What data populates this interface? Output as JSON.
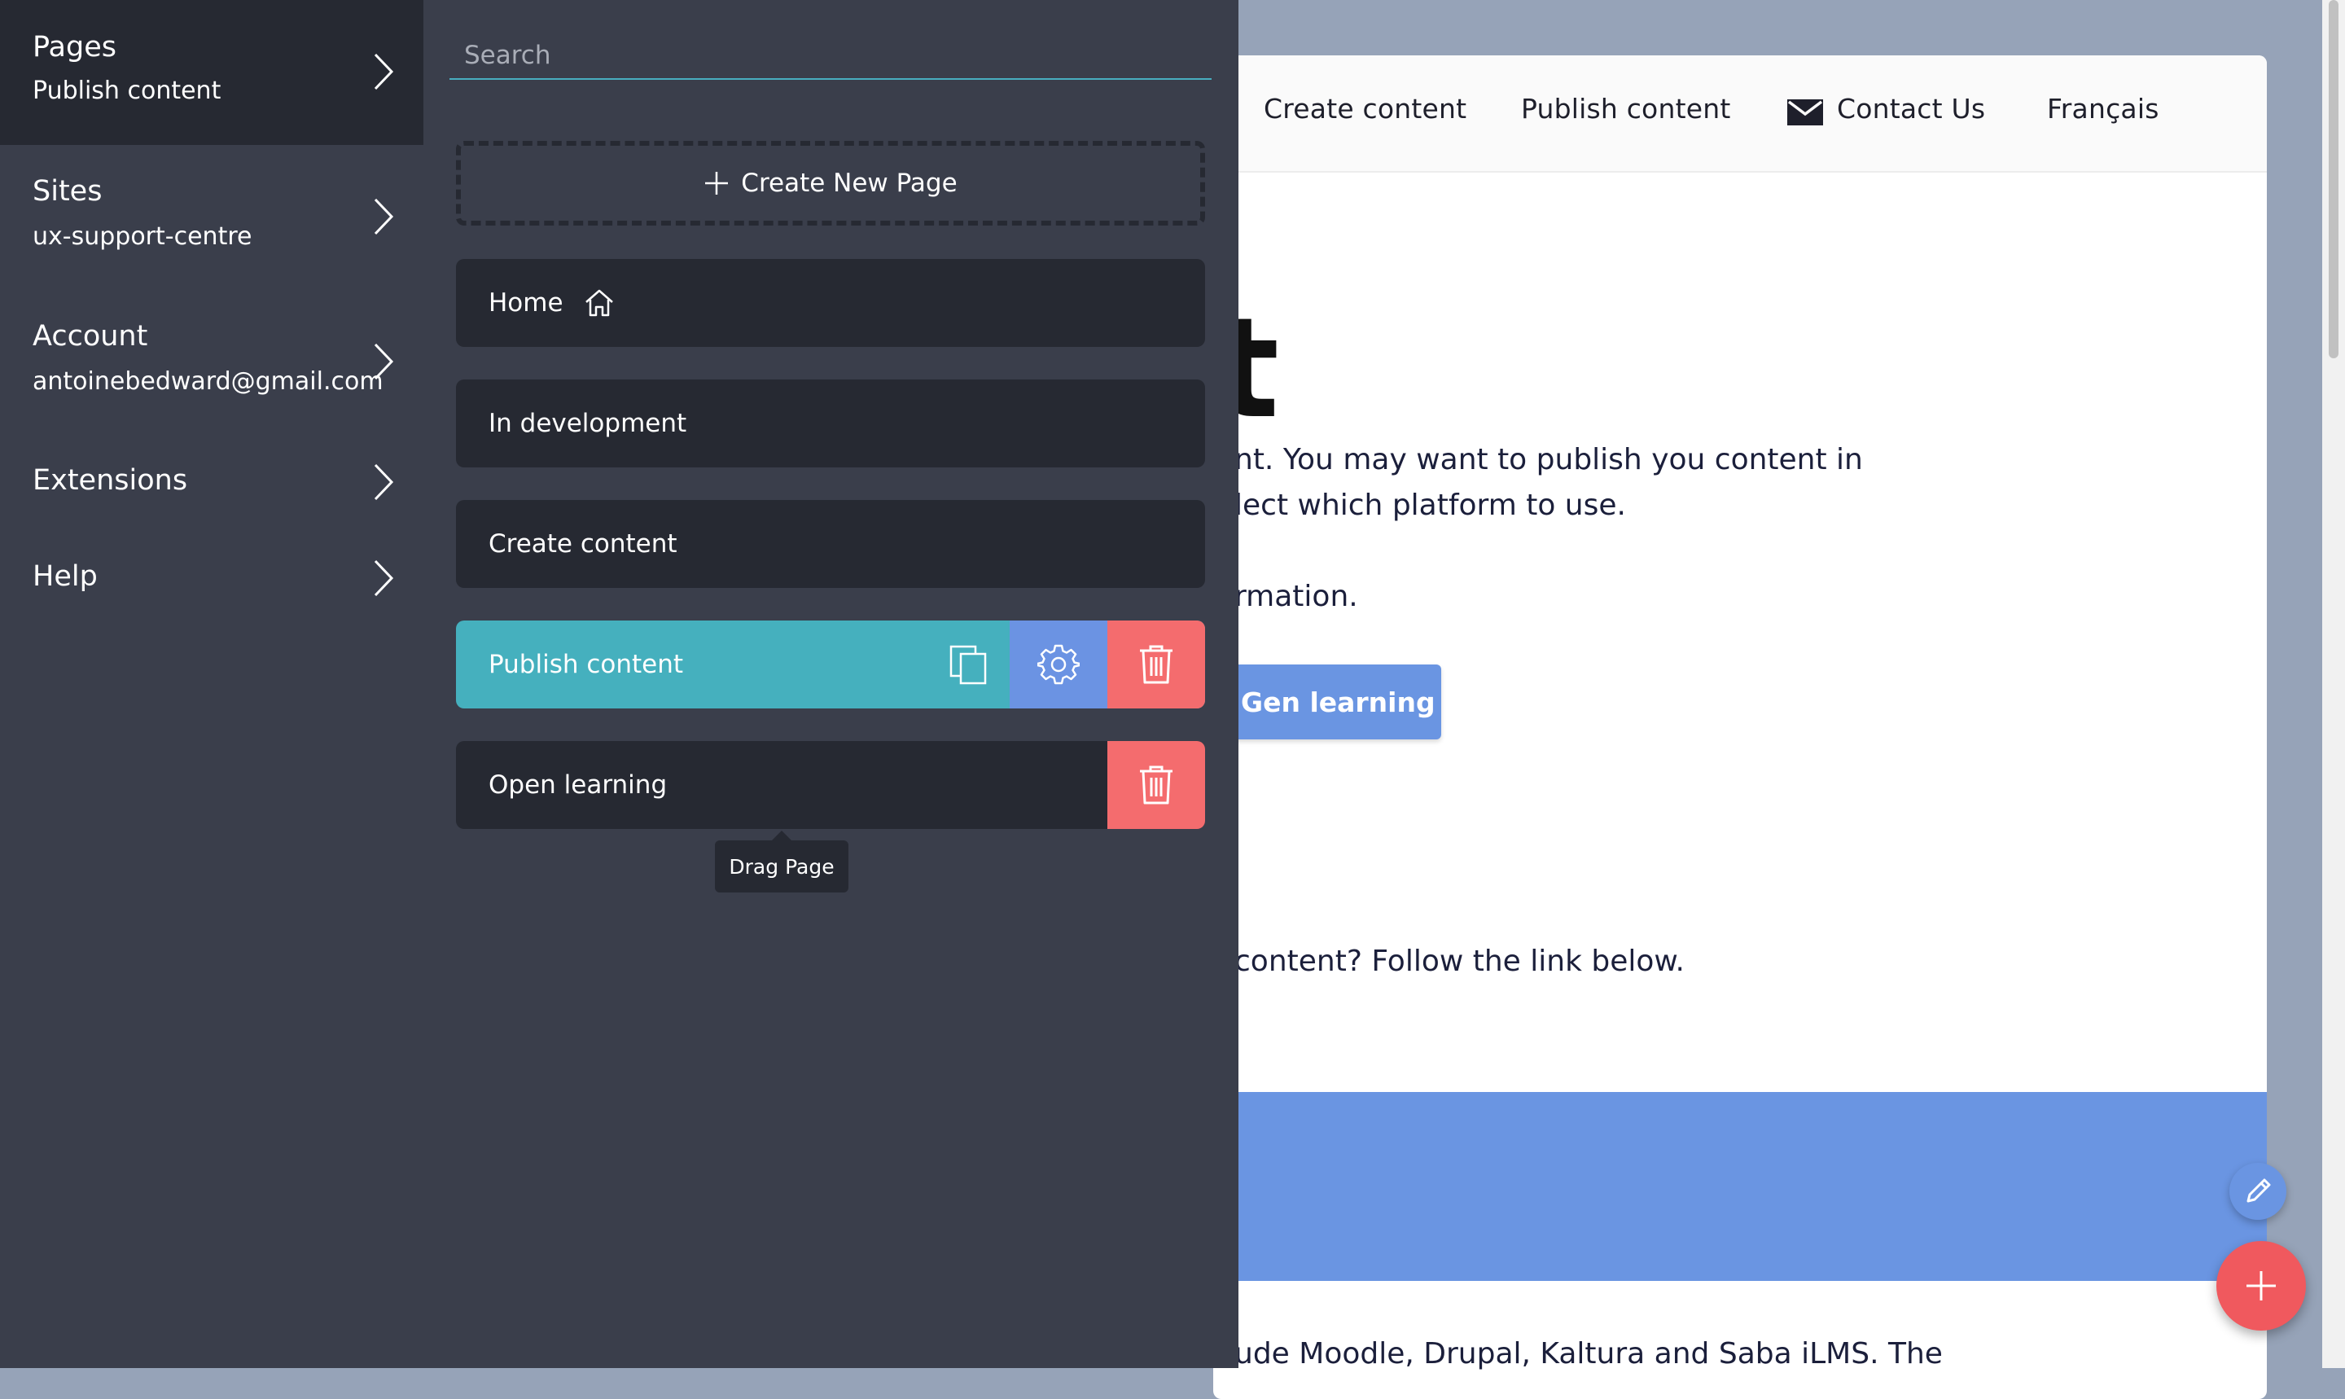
{
  "sidebar": {
    "items": [
      {
        "title": "Pages",
        "subtitle": "Publish content"
      },
      {
        "title": "Sites",
        "subtitle": "ux-support-centre"
      },
      {
        "title": "Account",
        "subtitle": "antoinebedward@gmail.com"
      },
      {
        "title": "Extensions",
        "subtitle": ""
      },
      {
        "title": "Help",
        "subtitle": ""
      }
    ]
  },
  "pages_panel": {
    "search_placeholder": "Search",
    "create_new_label": "Create New Page",
    "pages": [
      {
        "label": "Home"
      },
      {
        "label": "In development"
      },
      {
        "label": "Create content"
      },
      {
        "label": "Publish content"
      },
      {
        "label": "Open learning"
      }
    ],
    "tooltip": "Drag Page"
  },
  "preview": {
    "nav": {
      "create_content": "Create content",
      "publish_content": "Publish content",
      "contact_us": "Contact Us",
      "language": "Français"
    },
    "heading_fragment": "t",
    "paragraph_line1": "nt. You may want to publish you content in",
    "paragraph_line2": "lect which platform to use.",
    "paragraph_line3": "rmation.",
    "cta_label": "Gen learning",
    "paragraph_line4": "content? Follow the link below.",
    "paragraph_line5": "ude Moodle, Drupal, Kaltura and Saba iLMS. The"
  },
  "colors": {
    "sidebar_bg": "#3a3e4b",
    "item_bg": "#262932",
    "selected_teal": "#45b0be",
    "settings_blue": "#6b93e3",
    "delete_red": "#f46c6e",
    "preview_blue": "#6a95e2",
    "fab_red": "#f0595e"
  }
}
